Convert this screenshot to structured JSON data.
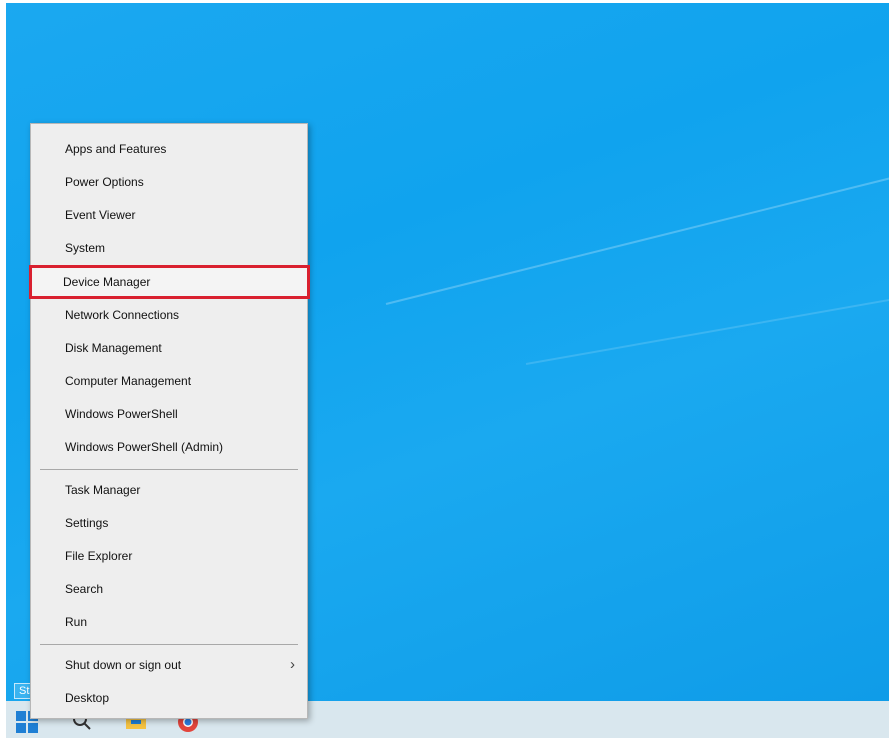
{
  "menu": {
    "items_top": [
      {
        "label": "Apps and Features"
      },
      {
        "label": "Power Options"
      },
      {
        "label": "Event Viewer"
      },
      {
        "label": "System"
      },
      {
        "label": "Device Manager"
      },
      {
        "label": "Network Connections"
      },
      {
        "label": "Disk Management"
      },
      {
        "label": "Computer Management"
      },
      {
        "label": "Windows PowerShell"
      },
      {
        "label": "Windows PowerShell (Admin)"
      }
    ],
    "items_mid": [
      {
        "label": "Task Manager"
      },
      {
        "label": "Settings"
      },
      {
        "label": "File Explorer"
      },
      {
        "label": "Search"
      },
      {
        "label": "Run"
      }
    ],
    "items_bottom": [
      {
        "label": "Shut down or sign out",
        "submenu_icon": "chevron-right-icon"
      },
      {
        "label": "Desktop"
      }
    ],
    "highlighted_item": "Device Manager",
    "highlight_color": "#d9202f"
  },
  "taskbar": {
    "start_tooltip": "Start",
    "icons": [
      "windows-start-icon",
      "search-icon",
      "file-explorer-icon",
      "browser-icon"
    ]
  },
  "colors": {
    "desktop": "#10a3ee",
    "menu_bg": "#eeeeee",
    "taskbar": "#d9e7ee"
  }
}
